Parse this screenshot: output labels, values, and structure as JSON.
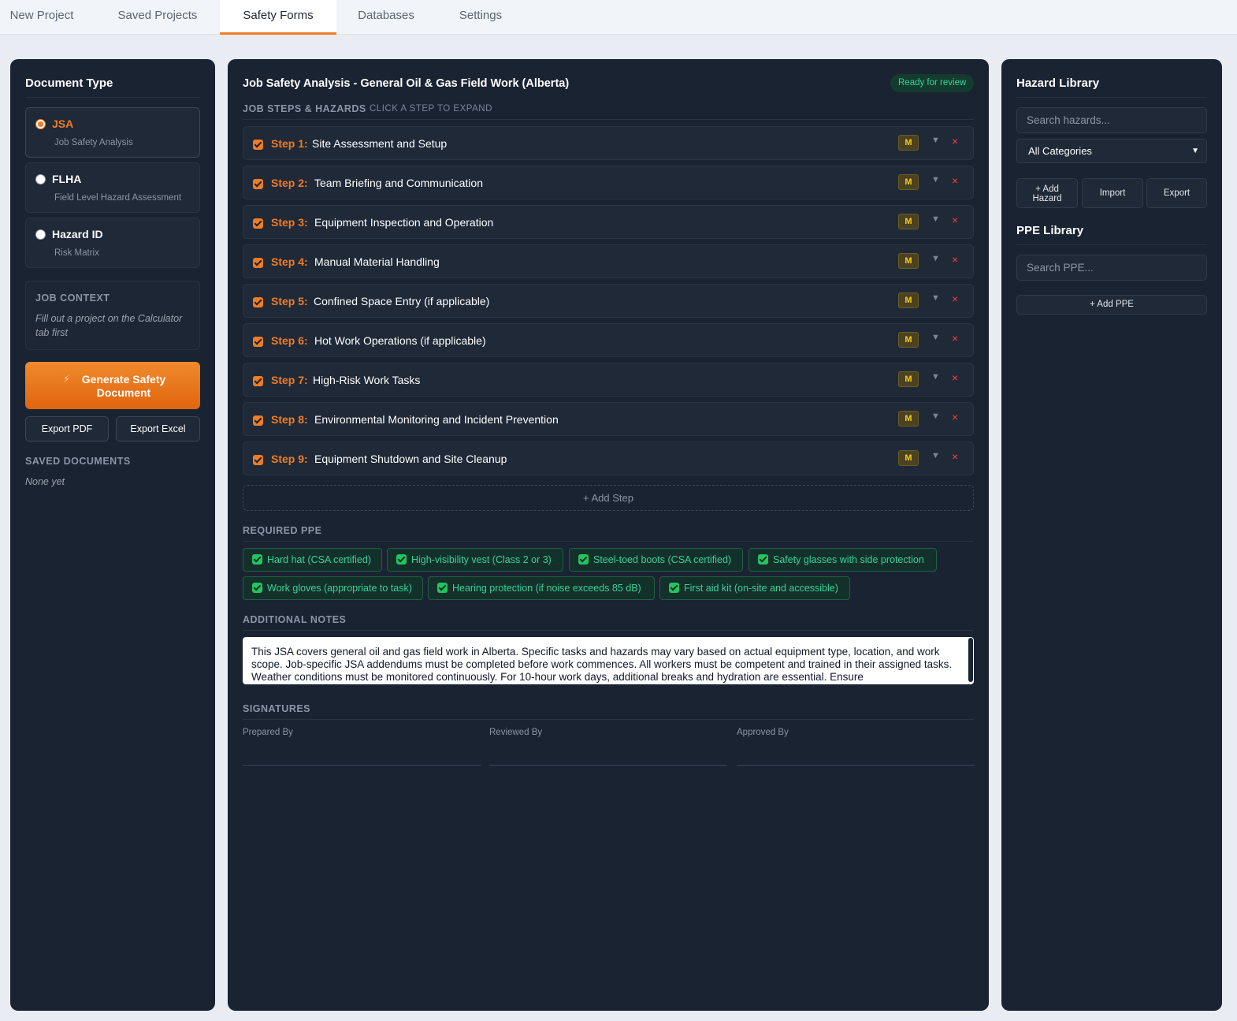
{
  "tabs": [
    {
      "label": "New Project",
      "active": false
    },
    {
      "label": "Saved Projects",
      "active": false
    },
    {
      "label": "Safety Forms",
      "active": true
    },
    {
      "label": "Databases",
      "active": false
    },
    {
      "label": "Settings",
      "active": false
    }
  ],
  "left": {
    "title": "Document Type",
    "doc_types": [
      {
        "name": "JSA",
        "sub": "Job Safety Analysis",
        "selected": true
      },
      {
        "name": "FLHA",
        "sub": "Field Level Hazard Assessment",
        "selected": false
      },
      {
        "name": "Hazard ID",
        "sub": "Risk Matrix",
        "selected": false
      }
    ],
    "job_context_label": "JOB CONTEXT",
    "job_context_text": "Fill out a project on the Calculator tab first",
    "generate_icon": "⚡",
    "generate_label": "Generate Safety Document",
    "export_pdf": "Export PDF",
    "export_excel": "Export Excel",
    "saved_docs_label": "SAVED DOCUMENTS",
    "saved_docs_empty": "None yet"
  },
  "center": {
    "title": "Job Safety Analysis - General Oil & Gas Field Work (Alberta)",
    "status_badge": "Ready for review",
    "steps_label": "JOB STEPS & HAZARDS",
    "steps_hint": "CLICK A STEP TO EXPAND",
    "steps": [
      {
        "num": "Step 1:",
        "title": "Site Assessment and Setup",
        "risk": "M"
      },
      {
        "num": "Step 2:",
        "title": "Team Briefing and Communication",
        "risk": "M"
      },
      {
        "num": "Step 3:",
        "title": "Equipment Inspection and Operation",
        "risk": "M"
      },
      {
        "num": "Step 4:",
        "title": "Manual Material Handling",
        "risk": "M"
      },
      {
        "num": "Step 5:",
        "title": "Confined Space Entry (if applicable)",
        "risk": "M"
      },
      {
        "num": "Step 6:",
        "title": "Hot Work Operations (if applicable)",
        "risk": "M"
      },
      {
        "num": "Step 7:",
        "title": "High-Risk Work Tasks",
        "risk": "M"
      },
      {
        "num": "Step 8:",
        "title": "Environmental Monitoring and Incident Prevention",
        "risk": "M"
      },
      {
        "num": "Step 9:",
        "title": "Equipment Shutdown and Site Cleanup",
        "risk": "M"
      }
    ],
    "expand_glyph": "▼",
    "delete_glyph": "×",
    "add_step": "+ Add Step",
    "ppe_label": "REQUIRED PPE",
    "ppe": [
      "Hard hat (CSA certified)",
      "High-visibility vest (Class 2 or 3)",
      "Steel-toed boots (CSA certified)",
      "Safety glasses with side protection",
      "Work gloves (appropriate to task)",
      "Hearing protection (if noise exceeds 85 dB)",
      "First aid kit (on-site and accessible)"
    ],
    "notes_label": "ADDITIONAL NOTES",
    "notes_text": "This JSA covers general oil and gas field work in Alberta. Specific tasks and hazards may vary based on actual equipment type, location, and work scope. Job-specific JSA addendums must be completed before work commences. All workers must be competent and trained in their assigned tasks. Weather conditions must be monitored continuously. For 10-hour work days, additional breaks and hydration are essential. Ensure",
    "signatures_label": "SIGNATURES",
    "signatures": [
      "Prepared By",
      "Reviewed By",
      "Approved By"
    ]
  },
  "right": {
    "hazard_title": "Hazard Library",
    "hazard_search_placeholder": "Search hazards...",
    "category_selected": "All Categories",
    "add_hazard": "+ Add Hazard",
    "import": "Import",
    "export": "Export",
    "ppe_title": "PPE Library",
    "ppe_search_placeholder": "Search PPE...",
    "add_ppe": "+ Add PPE"
  },
  "colors": {
    "accent": "#f07c24",
    "panel_bg": "#1a2332",
    "success": "#34d399",
    "risk_medium": "#facc15",
    "danger": "#ef4444"
  }
}
